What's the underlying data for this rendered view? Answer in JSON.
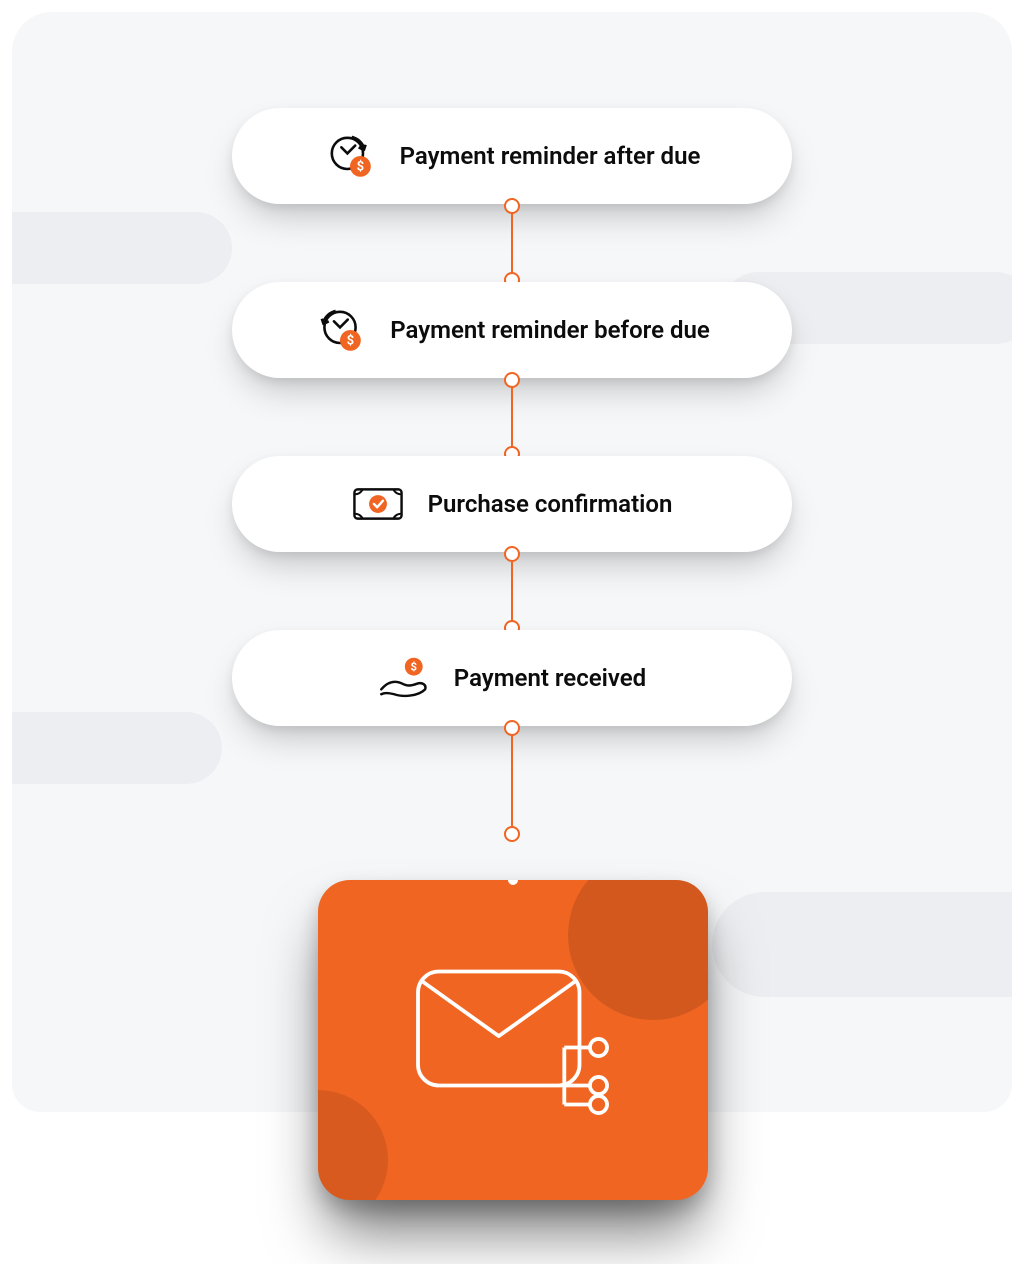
{
  "colors": {
    "accent": "#F16522"
  },
  "flow": {
    "steps": [
      {
        "icon": "clock-dollar-forward-icon",
        "label": "Payment reminder after due"
      },
      {
        "icon": "clock-dollar-back-icon",
        "label": "Payment reminder before due"
      },
      {
        "icon": "money-check-icon",
        "label": "Purchase confirmation"
      },
      {
        "icon": "hand-dollar-icon",
        "label": "Payment received"
      }
    ],
    "terminal": {
      "icon": "mail-automation-icon"
    }
  }
}
